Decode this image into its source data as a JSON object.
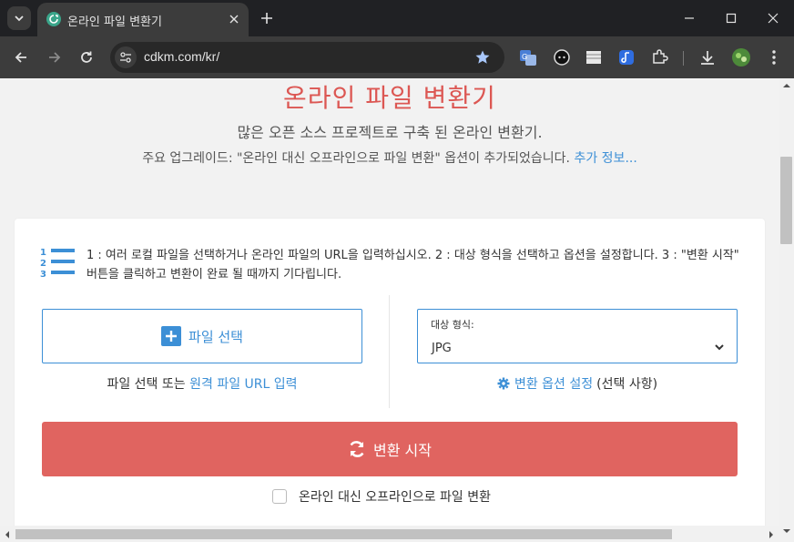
{
  "browser": {
    "tab_title": "온라인 파일 변환기",
    "url": "cdkm.com/kr/"
  },
  "page": {
    "title": "온라인 파일 변환기",
    "subtitle": "많은 오픈 소스 프로젝트로 구축 된 온라인 변환기.",
    "notice_text": "주요 업그레이드: \"온라인 대신 오프라인으로 파일 변환\" 옵션이 추가되었습니다.",
    "notice_link": "추가 정보...",
    "steps_text": "1 : 여러 로컬 파일을 선택하거나 온라인 파일의 URL을 입력하십시오. 2 : 대상 형식을 선택하고 옵션을 설정합니다. 3 : \"변환 시작\" 버튼을 클릭하고 변환이 완료 될 때까지 기다립니다.",
    "select_file_label": "파일 선택",
    "select_or_text": "파일 선택 또는",
    "remote_link": "원격 파일 URL 입력",
    "format_label": "대상 형식:",
    "format_value": "JPG",
    "options_link": "변환 옵션 설정",
    "options_suffix": "(선택 사항)",
    "convert_label": "변환 시작",
    "offline_label": "온라인 대신 오프라인으로 파일 변환"
  },
  "colors": {
    "accent": "#3c8fd6",
    "title_red": "#dc5753",
    "convert_button": "#e06460"
  }
}
